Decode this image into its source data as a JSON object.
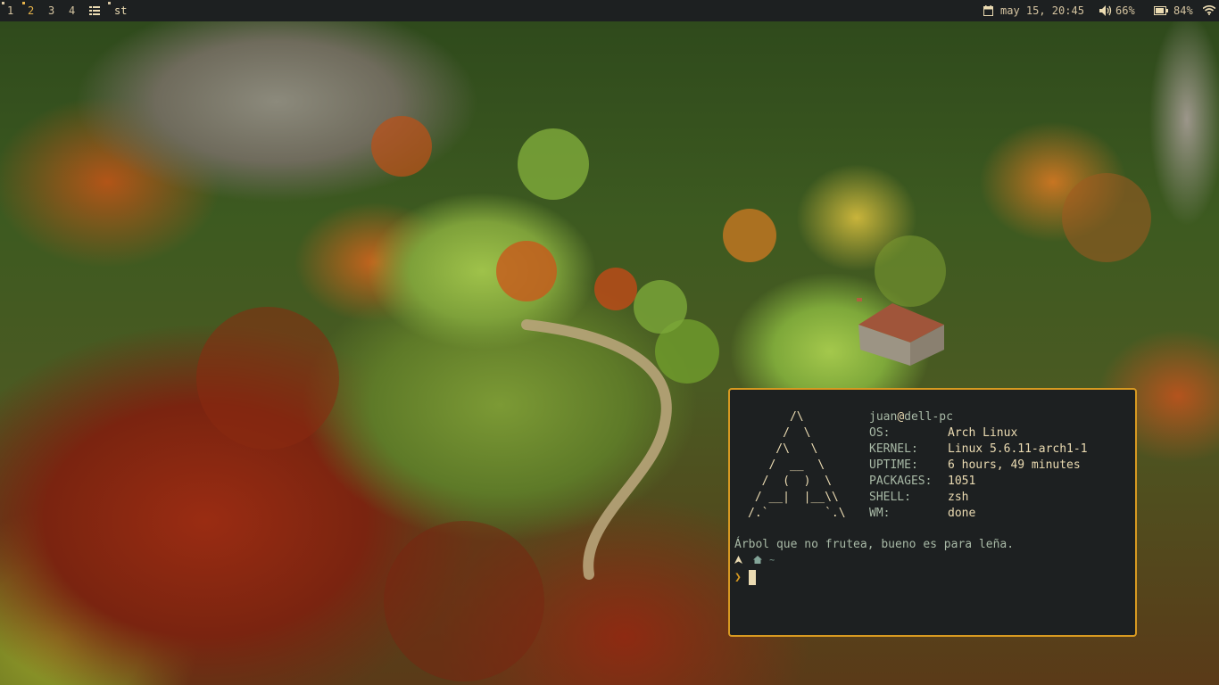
{
  "topbar": {
    "workspaces": [
      "1",
      "2",
      "3",
      "4"
    ],
    "active_workspace": "2",
    "window_title": "st",
    "date_time": "may 15, 20:45",
    "volume": "66%",
    "battery": "84%",
    "icons": {
      "layout": "tile-layout-icon",
      "calendar": "calendar-icon",
      "volume": "speaker-icon",
      "battery": "battery-icon",
      "wifi": "wifi-icon"
    }
  },
  "terminal": {
    "ascii_logo": "      /\\\n     /  \\\n    /\\   \\\n   /  __  \\\n  /  (  )  \\\n / __|  |__\\\\\n/.`        `.\\",
    "user": "juan",
    "at": "@",
    "host": "dell-pc",
    "info": [
      {
        "key": "OS:",
        "value": "Arch Linux"
      },
      {
        "key": "KERNEL:",
        "value": "Linux 5.6.11-arch1-1"
      },
      {
        "key": "UPTIME:",
        "value": "6 hours, 49 minutes"
      },
      {
        "key": "PACKAGES:",
        "value": "1051"
      },
      {
        "key": "SHELL:",
        "value": "zsh"
      },
      {
        "key": "WM:",
        "value": "done"
      }
    ],
    "quote": "Árbol que no frutea, bueno es para leña.",
    "prompt_dir": "~",
    "prompt_symbol": "❯"
  },
  "colors": {
    "bar_bg": "#1d2021",
    "accent": "#d79921",
    "fg": "#ebdbb2",
    "label": "#a8b9a6"
  }
}
